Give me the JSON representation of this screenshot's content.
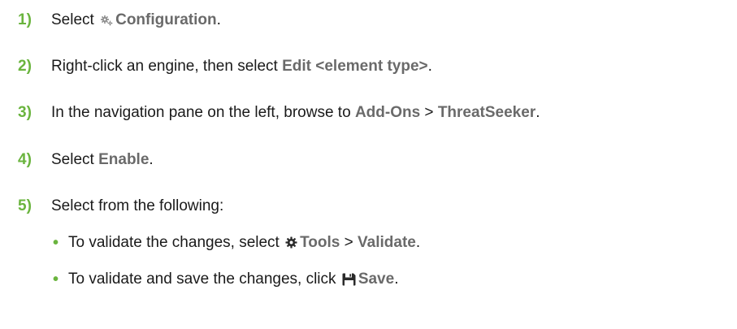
{
  "steps": [
    {
      "number": "1)",
      "before": "Select ",
      "icon": "gears-icon",
      "ui": "Configuration",
      "after": "."
    },
    {
      "number": "2)",
      "before": "Right-click an engine, then select ",
      "ui": "Edit <element type>",
      "after": "."
    },
    {
      "number": "3)",
      "before": "In the navigation pane on the left, browse to ",
      "ui1": "Add-Ons",
      "sep": " > ",
      "ui2": "ThreatSeeker",
      "after": "."
    },
    {
      "number": "4)",
      "before": "Select ",
      "ui": "Enable",
      "after": "."
    },
    {
      "number": "5)",
      "text": "Select from the following:"
    }
  ],
  "bullets": [
    {
      "marker": "•",
      "before": "To validate the changes, select ",
      "icon": "gear-icon",
      "ui1": "Tools",
      "sep": " > ",
      "ui2": "Validate",
      "after": "."
    },
    {
      "marker": "•",
      "before": "To validate and save the changes, click ",
      "icon": "save-icon",
      "ui": "Save",
      "after": "."
    }
  ],
  "colors": {
    "step_number": "#6ab43e",
    "ui_term": "#6a6a6a",
    "body_text": "#1a1a1a"
  }
}
